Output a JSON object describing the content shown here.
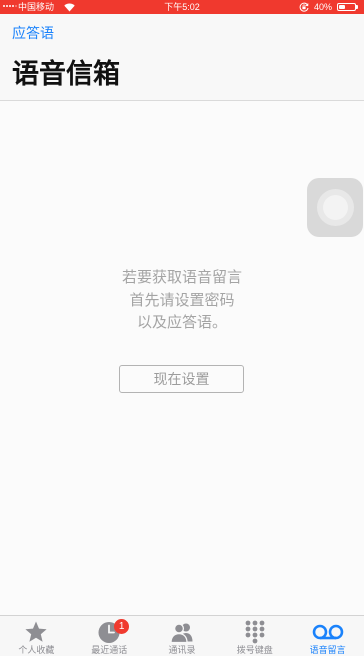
{
  "status_bar": {
    "carrier": "中国移动",
    "time": "下午5:02",
    "battery_percent": "40%",
    "battery_level": 0.4,
    "signal": {
      "filled": 4,
      "total": 5
    },
    "icons": [
      "signal-dots-icon",
      "wifi-icon",
      "rotation-lock-icon",
      "battery-icon"
    ]
  },
  "nav": {
    "back_label": "应答语",
    "title": "语音信箱"
  },
  "empty_state": {
    "lines": [
      "若要获取语音留言",
      "首先请设置密码",
      "以及应答语。"
    ],
    "button_label": "现在设置"
  },
  "assistive_touch": {
    "icon": "assistive-touch-icon"
  },
  "tab_bar": {
    "items": [
      {
        "label": "个人收藏",
        "icon": "star-icon",
        "selected": false
      },
      {
        "label": "最近通话",
        "icon": "clock-icon",
        "selected": false,
        "badge": "1"
      },
      {
        "label": "通讯录",
        "icon": "contacts-icon",
        "selected": false
      },
      {
        "label": "拨号键盘",
        "icon": "keypad-icon",
        "selected": false
      },
      {
        "label": "语音留言",
        "icon": "voicemail-icon",
        "selected": true
      }
    ]
  },
  "colors": {
    "accent": "#1a82fb",
    "badge": "#f03a2f",
    "status_bar": "#f0392e",
    "inactive_tab": "#8e8e93",
    "empty_text": "#a4a4a4"
  }
}
